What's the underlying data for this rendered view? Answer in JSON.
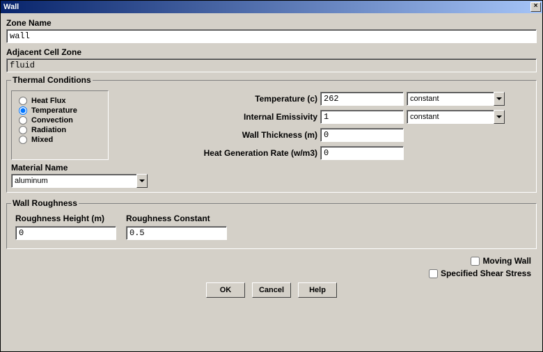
{
  "title": "Wall",
  "labels": {
    "zone_name": "Zone Name",
    "adjacent": "Adjacent Cell Zone",
    "thermal": "Thermal Conditions",
    "material": "Material Name",
    "roughness": "Wall Roughness",
    "rough_height": "Roughness Height (m)",
    "rough_const": "Roughness Constant"
  },
  "zone_name": "wall",
  "adjacent": "fluid",
  "thermal_options": {
    "heat_flux": "Heat Flux",
    "temperature": "Temperature",
    "convection": "Convection",
    "radiation": "Radiation",
    "mixed": "Mixed"
  },
  "thermal_selected": "temperature",
  "params": {
    "temp": {
      "label": "Temperature (c)",
      "value": "262",
      "combo": "constant"
    },
    "emiss": {
      "label": "Internal Emissivity",
      "value": "1",
      "combo": "constant"
    },
    "thick": {
      "label": "Wall Thickness (m)",
      "value": "0"
    },
    "hgr": {
      "label": "Heat Generation Rate (w/m3)",
      "value": "0"
    }
  },
  "material": "aluminum",
  "roughness": {
    "height": "0",
    "constant": "0.5"
  },
  "checks": {
    "moving": {
      "label": "Moving Wall",
      "checked": false
    },
    "shear": {
      "label": "Specified Shear Stress",
      "checked": false
    }
  },
  "buttons": {
    "ok": "OK",
    "cancel": "Cancel",
    "help": "Help"
  }
}
